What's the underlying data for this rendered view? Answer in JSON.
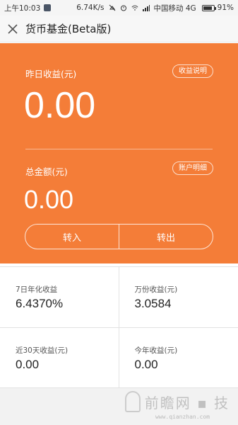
{
  "status_bar": {
    "time": "上午10:03",
    "net_speed": "6.74K/s",
    "carrier": "中国移动 4G",
    "battery": "91%",
    "battery_level": 0.91
  },
  "header": {
    "title": "货币基金(Beta版)",
    "close_icon": "close-icon"
  },
  "hero": {
    "yesterday_label": "昨日收益(元)",
    "yesterday_value": "0.00",
    "yesterday_link": "收益说明",
    "total_label": "总金额(元)",
    "total_value": "0.00",
    "total_link": "账户明细",
    "transfer_in": "转入",
    "transfer_out": "转出",
    "color": "#f47d38"
  },
  "stats": [
    {
      "label": "7日年化收益",
      "value": "6.4370%"
    },
    {
      "label": "万份收益(元)",
      "value": "3.0584"
    },
    {
      "label": "近30天收益(元)",
      "value": "0.00"
    },
    {
      "label": "今年收益(元)",
      "value": "0.00"
    }
  ],
  "watermark": {
    "text": "前瞻网 ▪ 技",
    "sub": "www.qianzhan.com"
  }
}
